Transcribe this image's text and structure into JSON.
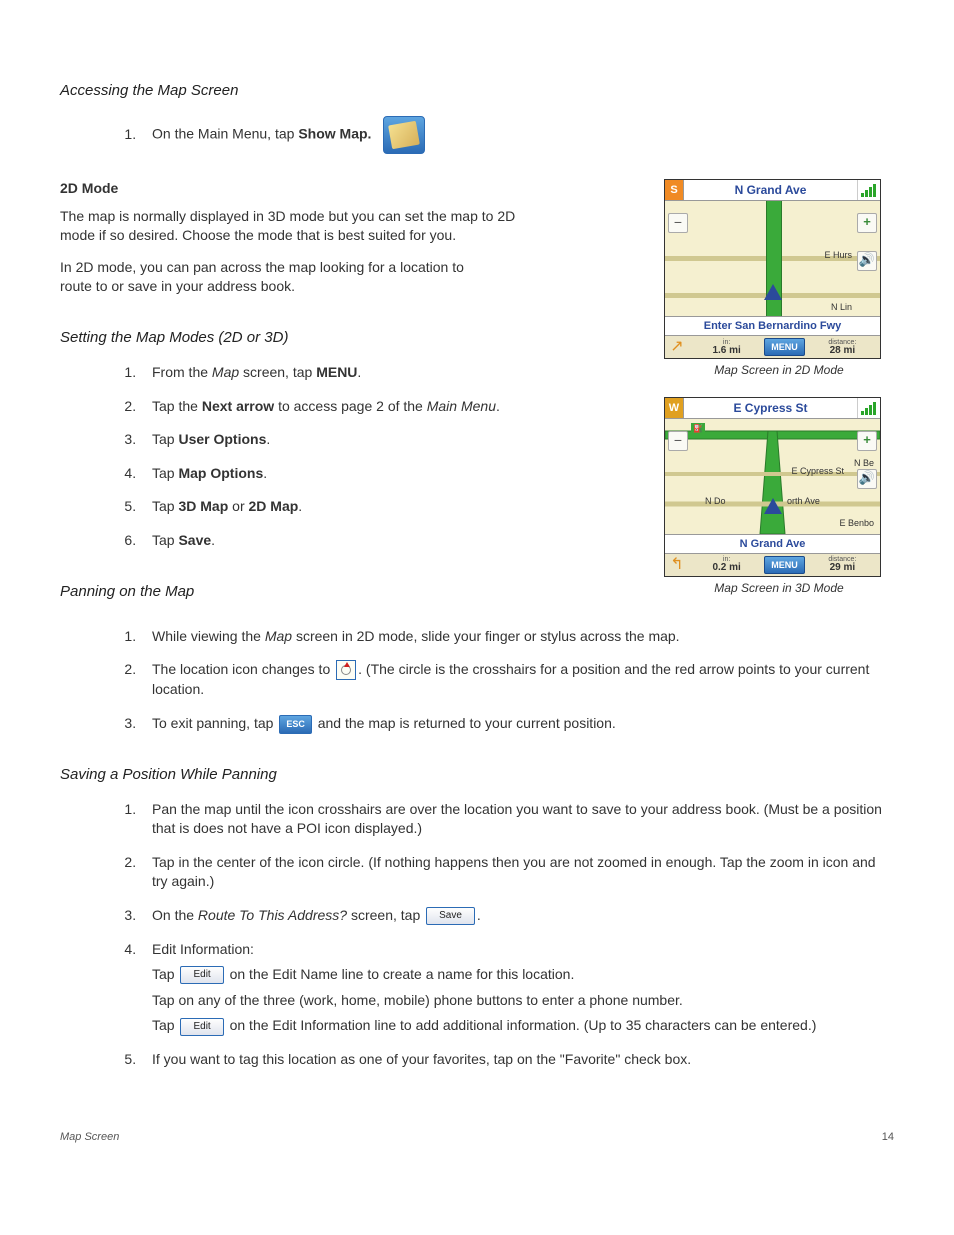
{
  "h1": "Accessing the Map Screen",
  "accessing_list": {
    "item1_pre": "On the Main Menu, tap ",
    "item1_bold": "Show Map."
  },
  "mode_heading": "2D Mode",
  "p_mode_1": "The map is normally displayed in 3D mode but you can set the map to 2D mode if so desired.  Choose the mode that is best suited for you.",
  "p_mode_2": "In 2D mode, you can pan across the map looking for a location to route to or save in your address book.",
  "setting_heading": "Setting the Map Modes (2D or 3D)",
  "setting_list": {
    "i1_pre": "From the ",
    "i1_it": "Map",
    "i1_mid": " screen, tap ",
    "i1_b": "MENU",
    "i1_post": ".",
    "i2_pre": "Tap the ",
    "i2_b": "Next arrow",
    "i2_mid": " to access page 2 of the ",
    "i2_it": "Main Menu",
    "i2_post": ".",
    "i3_pre": "Tap ",
    "i3_b": "User Options",
    "i3_post": ".",
    "i4_pre": "Tap ",
    "i4_b": "Map Options",
    "i4_post": ".",
    "i5_pre": "Tap ",
    "i5_b1": "3D Map",
    "i5_mid": " or ",
    "i5_b2": "2D Map",
    "i5_post": ".",
    "i6_pre": "Tap ",
    "i6_b": "Save",
    "i6_post": "."
  },
  "panning_heading": "Panning on the Map",
  "panning_list": {
    "i1_pre": "While viewing the ",
    "i1_it": "Map",
    "i1_post": " screen in 2D mode, slide your finger or stylus across the map.",
    "i2_pre": " The location icon changes to ",
    "i2_post": ".   (The circle is the crosshairs for a position and the red arrow points to your current location.",
    "i3_pre": "To exit panning, tap ",
    "i3_post": " and the map is returned to your current position."
  },
  "saving_heading": "Saving a Position While Panning",
  "saving_list": {
    "i1": "Pan the map until the icon crosshairs are over the location you want to save to your address book.  (Must be a position that is does not have a POI icon displayed.)",
    "i2": "Tap in the center of the icon circle. (If nothing happens then you are not zoomed in enough.  Tap the zoom in icon and try again.)",
    "i3_pre": "On the ",
    "i3_it": "Route To This Address?",
    "i3_mid": " screen, tap ",
    "i3_post": ".",
    "i4_head": "Edit Information:",
    "i4_l1_pre": "Tap ",
    "i4_l1_post": " on the Edit Name line to create a name for this location.",
    "i4_l2": "Tap on any of the three (work, home, mobile) phone buttons to enter a phone number.",
    "i4_l3_pre": "Tap ",
    "i4_l3_post": " on the Edit Information line to add additional information.  (Up to 35 characters can be entered.)",
    "i5": "If you want to tag this location as one of your favorites, tap on the \"Favorite\" check box."
  },
  "buttons": {
    "esc": "ESC",
    "save": "Save",
    "edit": "Edit"
  },
  "map2d": {
    "compass": "S",
    "top_street": "N Grand Ave",
    "label_e_hurs": "E Hurs",
    "label_n_lin": "N Lin",
    "enter_street": "Enter San Bernardino Fwy",
    "in_label": "in:",
    "in_val": "1.6 mi",
    "menu": "MENU",
    "dist_label": "distance:",
    "dist_val": "28 mi",
    "caption": "Map Screen in 2D Mode"
  },
  "map3d": {
    "compass": "W",
    "top_street": "E Cypress St",
    "label_cypress": "E Cypress St",
    "label_nbe": "N Be",
    "label_ndo": "N Do",
    "label_orth": "orth Ave",
    "label_benbo": "E Benbo",
    "bottom_street": "N Grand Ave",
    "in_label": "in:",
    "in_val": "0.2 mi",
    "menu": "MENU",
    "dist_label": "distance:",
    "dist_val": "29 mi",
    "caption": "Map Screen in 3D Mode"
  },
  "footer": {
    "left": "Map Screen",
    "right": "14"
  }
}
